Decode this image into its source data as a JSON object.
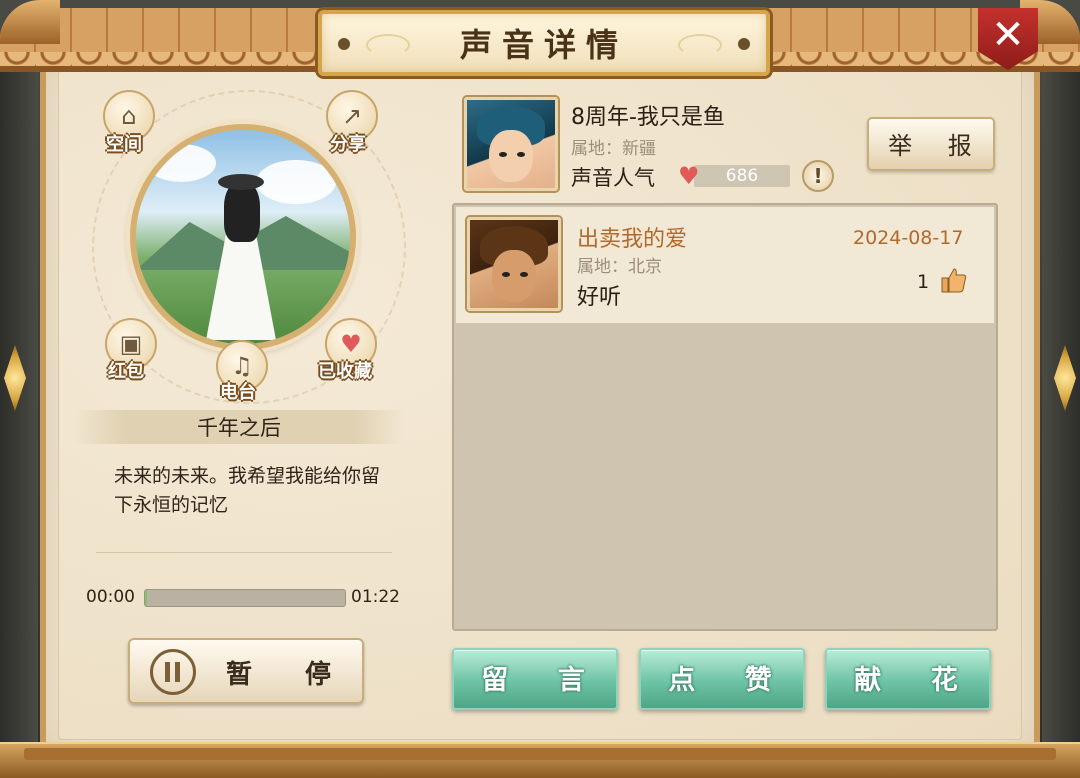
{
  "header": {
    "title": "声音详情"
  },
  "left": {
    "actions": {
      "space": "空间",
      "share": "分享",
      "red_packet": "红包",
      "radio": "电台",
      "favorited": "已收藏"
    },
    "song_title": "千年之后",
    "song_description": "未来的未来。我希望我能给你留下永恒的记忆",
    "player": {
      "current_time": "00:00",
      "total_time": "01:22",
      "progress_percent": 1,
      "pause_label": "暂 停"
    }
  },
  "uploader": {
    "name": "8周年-我只是鱼",
    "location": "属地：新疆",
    "popularity_label": "声音人气",
    "popularity_value": "686",
    "report_label": "举 报",
    "info_symbol": "!"
  },
  "comments": [
    {
      "name": "出卖我的爱",
      "location": "属地：北京",
      "text": "好听",
      "date": "2024-08-17",
      "likes": "1"
    }
  ],
  "buttons": {
    "message": "留 言",
    "like": "点 赞",
    "flower": "献 花"
  },
  "colors": {
    "accent_green": "#6dc3a5",
    "comment_name": "#b3692a",
    "heart": "#e05a5a",
    "close_red": "#c4312c"
  },
  "icons": {
    "close": "close-icon",
    "space": "home-icon",
    "share": "share-icon",
    "red_packet": "red-packet-icon",
    "radio": "gramophone-icon",
    "favorited": "heart-icon",
    "pause": "pause-icon",
    "popularity": "heart-icon",
    "info": "info-icon",
    "like": "thumbs-up-icon"
  }
}
